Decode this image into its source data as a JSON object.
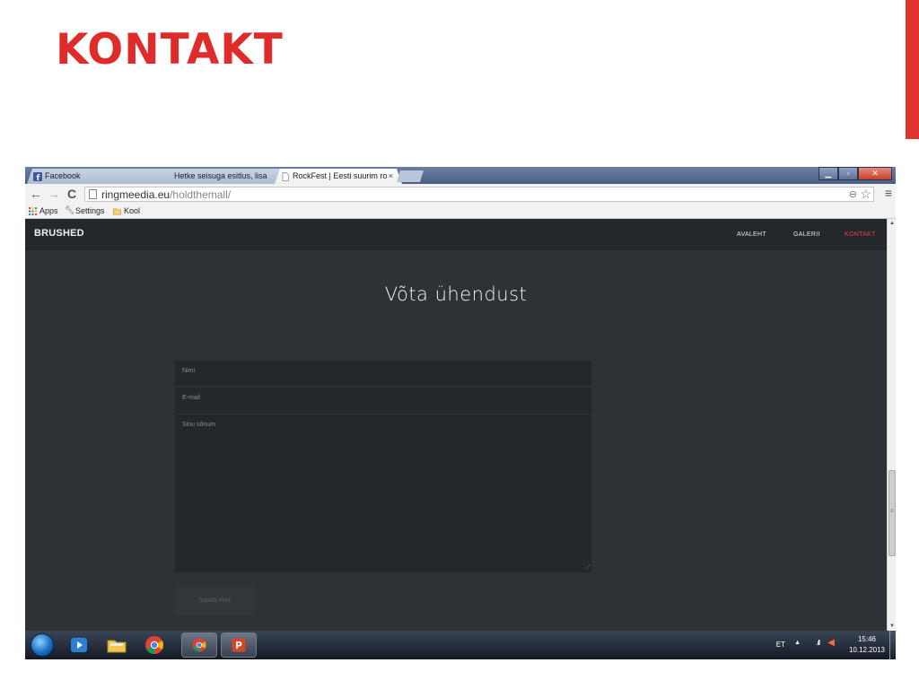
{
  "slide": {
    "title": "KONTAKT",
    "accent_color": "#e02b2b"
  },
  "browser": {
    "tabs": [
      {
        "label": "Facebook",
        "close": "×",
        "icon": "facebook-icon"
      },
      {
        "label": "Hetke seisuga esitlus, lisa",
        "close": "×",
        "icon": "page-icon"
      },
      {
        "label": "RockFest | Eesti suurim ro",
        "close": "×",
        "icon": "page-icon",
        "active": true
      }
    ],
    "url_host": "ringmeedia.eu",
    "url_path": "/holdthemall/",
    "bookmarks": [
      {
        "label": "Apps",
        "icon": "apps-grid-icon"
      },
      {
        "label": "Settings",
        "icon": "wrench-icon"
      },
      {
        "label": "Kool",
        "icon": "folder-icon"
      }
    ]
  },
  "site": {
    "brand": "BRUSHED",
    "nav": [
      {
        "label": "AVALEHT"
      },
      {
        "label": "GALERII"
      },
      {
        "label": "KONTAKT",
        "active": true
      }
    ],
    "heading": "Võta ühendust",
    "form": {
      "name_placeholder": "Nimi",
      "email_placeholder": "E-mail",
      "message_placeholder": "Sinu sõnum",
      "submit_label": "Saada meil"
    },
    "colors": {
      "background": "#2e3136",
      "header": "#24272b",
      "accent": "#e8463a"
    }
  },
  "taskbar": {
    "language": "ET",
    "time": "15:46",
    "date": "10.12.2013"
  }
}
